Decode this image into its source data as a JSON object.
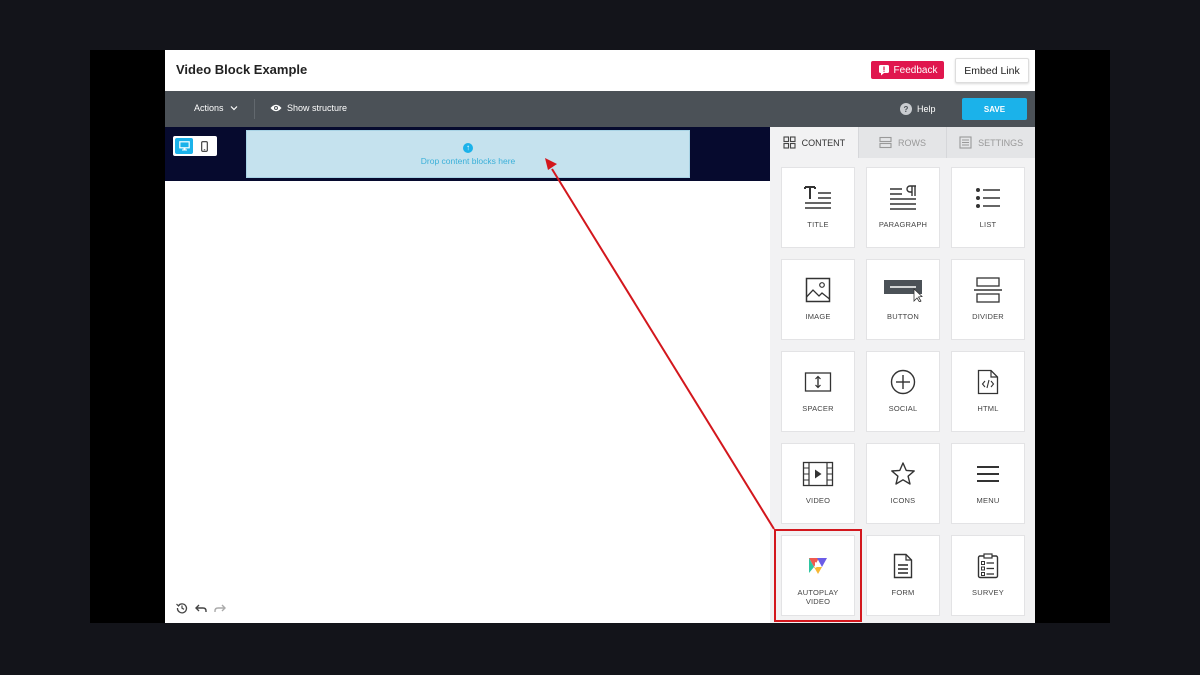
{
  "header": {
    "title": "Video Block Example",
    "feedback_label": "Feedback",
    "embed_label": "Embed Link"
  },
  "toolbar": {
    "actions_label": "Actions",
    "show_structure_label": "Show structure",
    "help_label": "Help",
    "save_label": "SAVE"
  },
  "canvas": {
    "drop_text": "Drop content blocks here"
  },
  "sidebar": {
    "tabs": [
      {
        "label": "CONTENT",
        "icon": "grid-icon",
        "active": true
      },
      {
        "label": "ROWS",
        "icon": "rows-icon",
        "active": false
      },
      {
        "label": "SETTINGS",
        "icon": "settings-icon",
        "active": false
      }
    ],
    "blocks": [
      {
        "label": "TITLE",
        "icon": "title-icon"
      },
      {
        "label": "PARAGRAPH",
        "icon": "paragraph-icon"
      },
      {
        "label": "LIST",
        "icon": "list-icon"
      },
      {
        "label": "IMAGE",
        "icon": "image-icon"
      },
      {
        "label": "BUTTON",
        "icon": "button-icon"
      },
      {
        "label": "DIVIDER",
        "icon": "divider-icon"
      },
      {
        "label": "SPACER",
        "icon": "spacer-icon"
      },
      {
        "label": "SOCIAL",
        "icon": "social-icon"
      },
      {
        "label": "HTML",
        "icon": "html-icon"
      },
      {
        "label": "VIDEO",
        "icon": "video-icon"
      },
      {
        "label": "ICONS",
        "icon": "star-icon"
      },
      {
        "label": "MENU",
        "icon": "menu-icon"
      },
      {
        "label": "AUTOPLAY\nVIDEO",
        "icon": "autoplay-video-icon"
      },
      {
        "label": "FORM",
        "icon": "form-icon"
      },
      {
        "label": "SURVEY",
        "icon": "survey-icon"
      }
    ]
  },
  "colors": {
    "accent": "#1bb2ea",
    "feedback": "#e0164e",
    "annotation": "#d3171d",
    "toolbar": "#4b5157",
    "stage": "#060a2e"
  }
}
